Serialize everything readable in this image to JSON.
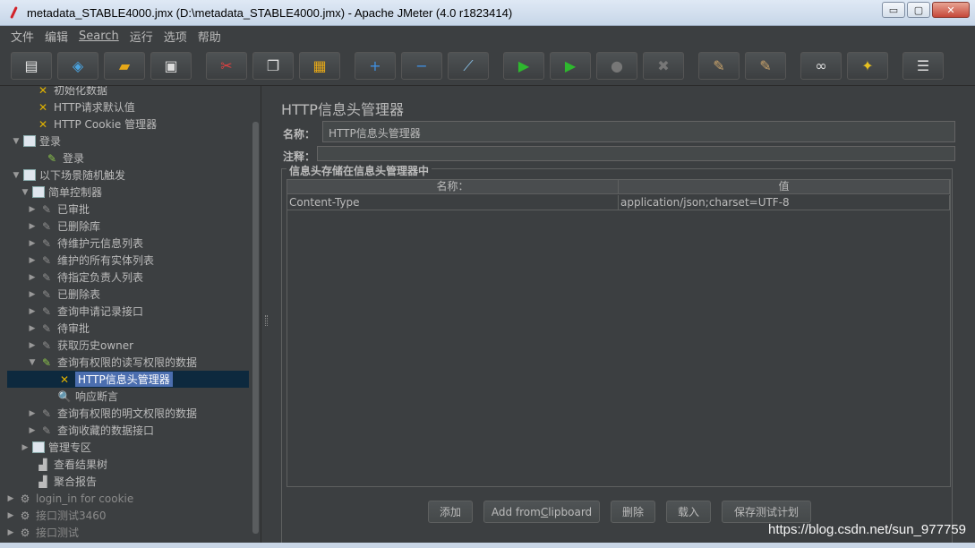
{
  "window": {
    "title": "metadata_STABLE4000.jmx (D:\\metadata_STABLE4000.jmx) - Apache JMeter (4.0 r1823414)",
    "minimize": "▭",
    "maximize": "▢",
    "close": "✕"
  },
  "menu": [
    "文件",
    "编辑",
    "Search",
    "运行",
    "选项",
    "帮助"
  ],
  "toolbar": [
    {
      "name": "new-icon",
      "glyph": "▤",
      "color": "#e9e9e9"
    },
    {
      "name": "templates-icon",
      "glyph": "◈",
      "color": "#4aa3df"
    },
    {
      "name": "open-icon",
      "glyph": "▰",
      "color": "#e6a818"
    },
    {
      "name": "save-icon",
      "glyph": "▣",
      "color": "#dddddd"
    },
    {
      "name": "cut-icon",
      "glyph": "✂",
      "color": "#e04040"
    },
    {
      "name": "copy-icon",
      "glyph": "❐",
      "color": "#dddddd"
    },
    {
      "name": "paste-icon",
      "glyph": "▦",
      "color": "#e6a818"
    },
    {
      "name": "expand-icon",
      "glyph": "+",
      "color": "#3f8fe0"
    },
    {
      "name": "collapse-icon",
      "glyph": "−",
      "color": "#3f8fe0"
    },
    {
      "name": "toggle-icon",
      "glyph": "⟋",
      "color": "#88c0e8"
    },
    {
      "name": "start-icon",
      "glyph": "▶",
      "color": "#2eb82e"
    },
    {
      "name": "start-no-pauses-icon",
      "glyph": "▶",
      "color": "#2eb82e"
    },
    {
      "name": "stop-icon",
      "glyph": "●",
      "color": "#777777"
    },
    {
      "name": "shutdown-icon",
      "glyph": "✖",
      "color": "#777777"
    },
    {
      "name": "clear-icon",
      "glyph": "✎",
      "color": "#c9a36b"
    },
    {
      "name": "clear-all-icon",
      "glyph": "✎",
      "color": "#c9a36b"
    },
    {
      "name": "search-icon",
      "glyph": "∞",
      "color": "#dddddd"
    },
    {
      "name": "reset-search-icon",
      "glyph": "✦",
      "color": "#e6c020"
    },
    {
      "name": "function-helper-icon",
      "glyph": "☰",
      "color": "#dddddd"
    }
  ],
  "tree": [
    {
      "label": "初始化数据",
      "icon": "tool",
      "toggle": ""
    },
    {
      "label": "HTTP请求默认值",
      "icon": "tool",
      "toggle": ""
    },
    {
      "label": "HTTP Cookie 管理器",
      "icon": "tool",
      "toggle": ""
    },
    {
      "label": "登录",
      "icon": "ctrl",
      "toggle": "▼"
    },
    {
      "label": "登录",
      "icon": "pencil",
      "toggle": ""
    },
    {
      "label": "以下场景随机触发",
      "icon": "ctrl",
      "toggle": "▼"
    },
    {
      "label": "简单控制器",
      "icon": "ctrl",
      "toggle": "▼"
    },
    {
      "label": "已审批",
      "icon": "pencil-grey",
      "toggle": "▶"
    },
    {
      "label": "已删除库",
      "icon": "pencil-grey",
      "toggle": "▶"
    },
    {
      "label": "待维护元信息列表",
      "icon": "pencil-grey",
      "toggle": "▶"
    },
    {
      "label": "维护的所有实体列表",
      "icon": "pencil-grey",
      "toggle": "▶"
    },
    {
      "label": "待指定负责人列表",
      "icon": "pencil-grey",
      "toggle": "▶"
    },
    {
      "label": "已删除表",
      "icon": "pencil-grey",
      "toggle": "▶"
    },
    {
      "label": "查询申请记录接口",
      "icon": "pencil-grey",
      "toggle": "▶"
    },
    {
      "label": "待审批",
      "icon": "pencil-grey",
      "toggle": "▶"
    },
    {
      "label": "获取历史owner",
      "icon": "pencil-grey",
      "toggle": "▶"
    },
    {
      "label": "查询有权限的读写权限的数据",
      "icon": "pencil",
      "toggle": "▼"
    },
    {
      "label": "HTTP信息头管理器",
      "icon": "tool",
      "toggle": ""
    },
    {
      "label": "响应断言",
      "icon": "search",
      "toggle": ""
    },
    {
      "label": "查询有权限的明文权限的数据",
      "icon": "pencil-grey",
      "toggle": "▶"
    },
    {
      "label": "查询收藏的数据接口",
      "icon": "pencil-grey",
      "toggle": "▶"
    },
    {
      "label": "管理专区",
      "icon": "ctrl",
      "toggle": "▶"
    },
    {
      "label": "查看结果树",
      "icon": "chart",
      "toggle": ""
    },
    {
      "label": "聚合报告",
      "icon": "chart",
      "toggle": ""
    },
    {
      "label": "login_in for cookie",
      "icon": "gear",
      "toggle": "▶"
    },
    {
      "label": "接口测试3460",
      "icon": "gear",
      "toggle": "▶"
    },
    {
      "label": "接口测试",
      "icon": "gear",
      "toggle": "▶"
    }
  ],
  "panel": {
    "title": "HTTP信息头管理器",
    "name_label": "名称：",
    "name_value": "HTTP信息头管理器",
    "comment_label": "注释：",
    "comment_value": "",
    "group_title": "信息头存储在信息头管理器中",
    "columns": [
      "名称：",
      "值"
    ],
    "rows": [
      [
        "Content-Type",
        "application/json;charset=UTF-8"
      ]
    ],
    "buttons": {
      "add": "添加",
      "add_from_clipboard_pre": "Add from ",
      "add_from_clipboard_u": "C",
      "add_from_clipboard_post": "lipboard",
      "delete": "删除",
      "load": "载入",
      "save_test_plan": "保存测试计划"
    }
  },
  "watermark": "https://blog.csdn.net/sun_977759"
}
